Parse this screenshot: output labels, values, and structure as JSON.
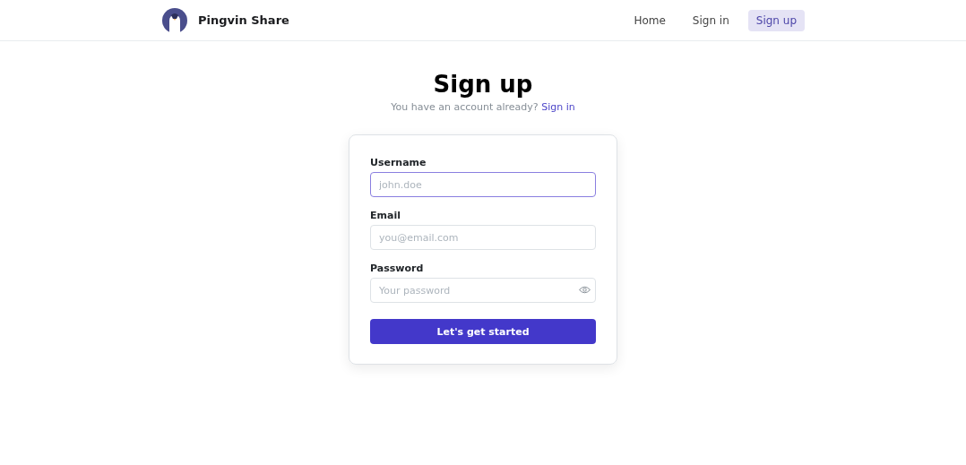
{
  "header": {
    "brand": "Pingvin Share",
    "nav": [
      {
        "label": "Home",
        "selected": false
      },
      {
        "label": "Sign in",
        "selected": false
      },
      {
        "label": "Sign up",
        "selected": true
      }
    ]
  },
  "title": "Sign up",
  "subtitle": "You have an account already?",
  "subtitle_link": "Sign in",
  "form": {
    "fields": [
      {
        "label": "Username",
        "placeholder": "john.doe",
        "focused": true,
        "kind": "text"
      },
      {
        "label": "Email",
        "placeholder": "you@email.com",
        "focused": false,
        "kind": "text"
      },
      {
        "label": "Password",
        "placeholder": "Your password",
        "focused": false,
        "kind": "password"
      }
    ],
    "submit": "Let's get started"
  }
}
